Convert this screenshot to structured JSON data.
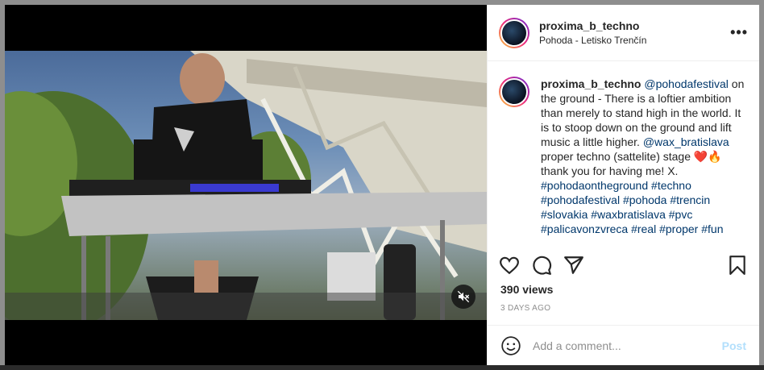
{
  "post": {
    "username": "proxima_b_techno",
    "location": "Pohoda - Letisko Trenčín",
    "more_label": "•••",
    "caption": {
      "username": "proxima_b_techno",
      "segments": [
        {
          "text": "@pohodafestival",
          "tag": true
        },
        {
          "text": " on the ground - There is a loftier ambition than merely to stand high in the world. It is to stoop down on the ground and lift music a little higher. ",
          "tag": false
        },
        {
          "text": "@wax_bratislava",
          "tag": true
        },
        {
          "text": " proper techno (sattelite) stage ❤️🔥thank you for having me! X. ",
          "tag": false
        },
        {
          "text": "#pohodaontheground",
          "tag": true
        },
        {
          "text": " ",
          "tag": false
        },
        {
          "text": "#techno",
          "tag": true
        },
        {
          "text": " ",
          "tag": false
        },
        {
          "text": "#pohodafestival",
          "tag": true
        },
        {
          "text": " ",
          "tag": false
        },
        {
          "text": "#pohoda",
          "tag": true
        },
        {
          "text": " ",
          "tag": false
        },
        {
          "text": "#trencin",
          "tag": true
        },
        {
          "text": " ",
          "tag": false
        },
        {
          "text": "#slovakia",
          "tag": true
        },
        {
          "text": " ",
          "tag": false
        },
        {
          "text": "#waxbratislava",
          "tag": true
        },
        {
          "text": " ",
          "tag": false
        },
        {
          "text": "#pvc",
          "tag": true
        },
        {
          "text": " ",
          "tag": false
        },
        {
          "text": "#palicavonzvreca",
          "tag": true
        },
        {
          "text": " ",
          "tag": false
        },
        {
          "text": "#real",
          "tag": true
        },
        {
          "text": " ",
          "tag": false
        },
        {
          "text": "#proper",
          "tag": true
        },
        {
          "text": " ",
          "tag": false
        },
        {
          "text": "#fun",
          "tag": true
        }
      ]
    },
    "views": "390 views",
    "date": "3 DAYS AGO"
  },
  "icons": {
    "like": "heart-icon",
    "comment": "comment-icon",
    "share": "paper-plane-icon",
    "save": "bookmark-icon",
    "emoji": "smiley-icon",
    "mute": "speaker-muted-icon"
  },
  "composer": {
    "placeholder": "Add a comment...",
    "post_label": "Post"
  },
  "colors": {
    "link": "#00376b",
    "post_disabled": "#b2dffc"
  }
}
